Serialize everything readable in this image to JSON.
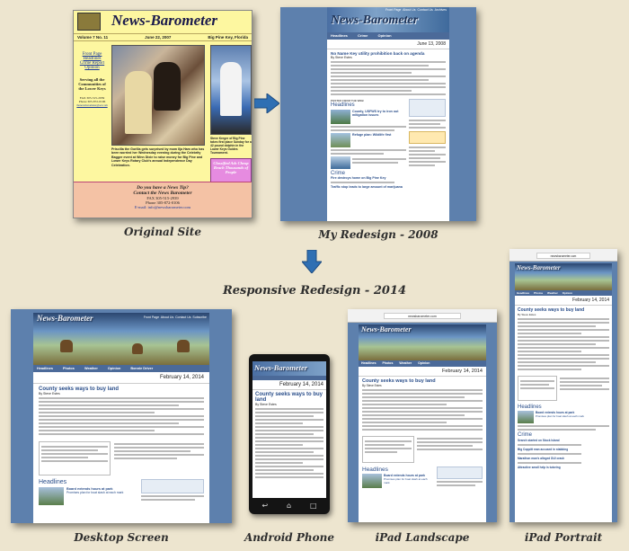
{
  "captions": {
    "original": "Original Site",
    "redesign2008": "My Redesign - 2008",
    "responsive_title": "Responsive Redesign - 2014",
    "desktop": "Desktop Screen",
    "android": "Android Phone",
    "ipad_landscape": "iPad Landscape",
    "ipad_portrait": "iPad Portrait"
  },
  "original_site": {
    "masthead": "News-Barometer",
    "volume": "Volume 7 No. 11",
    "date": "June 22, 2007",
    "location": "Big Pine Key, Florida",
    "links": [
      "Front Page",
      "Headlines",
      "Crime Report",
      "Opinion"
    ],
    "serving": "Serving all the Communities of the Lower Keys",
    "fax": "FAX 305-515-2939",
    "phone": "Phone 305-872-0106",
    "email": "thenewsbarometer@aol.com",
    "photo_caption_left": "Priscilla the Gorilla gets surprised by mom Ilja Ham who has been worried her Wednesday evening during the Celebrity Bagger event at Winn Dixie to raise money for Big Pine and Lower Keys Rotary Club's annual Independence Day Celebration.",
    "photo_caption_right": "Steve Kreger of Big Pine takes first place Sunday for a 42 pound dolphin in the Lower Keys Guides Tournament.",
    "hd_box": "Classified Ads Cheap Reach Thousands of People",
    "footer_q": "Do you have a News Tip?",
    "footer_contact": "Contact the News Barometer",
    "footer_fax": "FAX 305-515-2939",
    "footer_phone": "Phone 305-872-0106",
    "footer_email": "E-mail: info@newsbarometer.com"
  },
  "redesign_2008": {
    "masthead": "News-Barometer",
    "nav": [
      "Headlines",
      "Crime",
      "Opinion"
    ],
    "toplinks": [
      "Front Page",
      "About Us",
      "Contact Us",
      "Archives"
    ],
    "date": "June 13, 2008",
    "headline": "No Name Key utility prohibition back on agenda",
    "byline": "By Steve Estes",
    "section1": "Headlines",
    "story1": "County, USFWS try to iron out mitigation issues",
    "story2": "Refuge plan: Wildlife first",
    "section2": "Crime",
    "story3": "Fire destroys home on Big Pine Key",
    "story4": "Traffic stop leads to large amount of marijuana",
    "side_header": "POSTED FROM THE WEB"
  },
  "desktop": {
    "masthead": "News-Barometer",
    "toplinks": [
      "Front Page",
      "About Us",
      "Contact Us",
      "Subscribe"
    ],
    "nav": [
      "Headlines",
      "Photos",
      "Weather",
      "Opinion",
      "Bonnie Driver"
    ],
    "date": "February 14, 2014",
    "headline": "County seeks ways to buy land",
    "byline": "By Steve Estes",
    "section": "Headlines",
    "story1": "Board extends hours at park",
    "story2": "Promises plan for boat slash at each mark"
  },
  "android": {
    "masthead": "News-Barometer",
    "date": "February 14, 2014",
    "headline": "County seeks ways to buy land",
    "byline": "By Steve Estes"
  },
  "ipad_landscape": {
    "url": "newsbarometer.com",
    "masthead": "News-Barometer",
    "nav": [
      "Headlines",
      "Photos",
      "Weather",
      "Opinion"
    ],
    "date": "February 14, 2014",
    "headline": "County seeks ways to buy land",
    "byline": "By Steve Estes",
    "section": "Headlines",
    "story1": "Board extends hours at park",
    "story2": "Promises plan for boat slash at each mark"
  },
  "ipad_portrait": {
    "url": "newsbarometer.com",
    "masthead": "News-Barometer",
    "nav": [
      "Headlines",
      "Photos",
      "Weather",
      "Opinion"
    ],
    "date": "February 14, 2014",
    "headline": "County seeks ways to buy land",
    "byline": "By Steve Estes",
    "section1": "Headlines",
    "story1": "Board extends hours at park",
    "story2": "Promises plan for boat slash at each mark",
    "section2": "Crime",
    "story3": "Search started on Stock Island",
    "story4": "Big Coppitt man accused in stabbing",
    "story5": "Marathon man's alleged DUI crash",
    "story6": "Attractive small help is tutoring"
  },
  "colors": {
    "background": "#ede5cf",
    "site_blue": "#5d80ad",
    "arrow_blue": "#2f6fb3",
    "headline_blue": "#2a4e8a"
  }
}
